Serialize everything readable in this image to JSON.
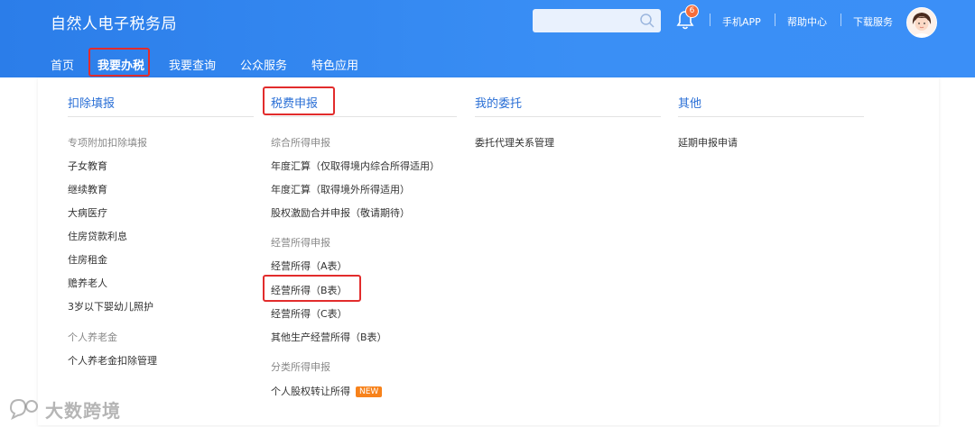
{
  "header": {
    "brand": "自然人电子税务局",
    "notification_count": "6",
    "links": {
      "app": "手机APP",
      "help": "帮助中心",
      "download": "下载服务"
    }
  },
  "nav": {
    "items": [
      "首页",
      "我要办税",
      "我要查询",
      "公众服务",
      "特色应用"
    ]
  },
  "columns": {
    "c1": {
      "title": "扣除填报",
      "g1": "专项附加扣除填报",
      "g1_items": [
        "子女教育",
        "继续教育",
        "大病医疗",
        "住房贷款利息",
        "住房租金",
        "赡养老人",
        "3岁以下婴幼儿照护"
      ],
      "g2": "个人养老金",
      "g2_items": [
        "个人养老金扣除管理"
      ]
    },
    "c2": {
      "title": "税费申报",
      "g1": "综合所得申报",
      "g1_items": [
        "年度汇算（仅取得境内综合所得适用）",
        "年度汇算（取得境外所得适用）",
        "股权激励合并申报（敬请期待）"
      ],
      "g2": "经营所得申报",
      "g2_items": [
        "经营所得（A表）",
        "经营所得（B表）",
        "经营所得（C表）",
        "其他生产经营所得（B表）"
      ],
      "g3": "分类所得申报",
      "g3_items": [
        "个人股权转让所得"
      ],
      "new_tag": "NEW"
    },
    "c3": {
      "title": "我的委托",
      "items": [
        "委托代理关系管理"
      ]
    },
    "c4": {
      "title": "其他",
      "items": [
        "延期申报申请"
      ]
    }
  },
  "watermark": "大数跨境",
  "colors": {
    "header": "#2b7de9",
    "highlight": "#e22c2c",
    "title": "#2a6fd6",
    "new": "#f7821b"
  }
}
